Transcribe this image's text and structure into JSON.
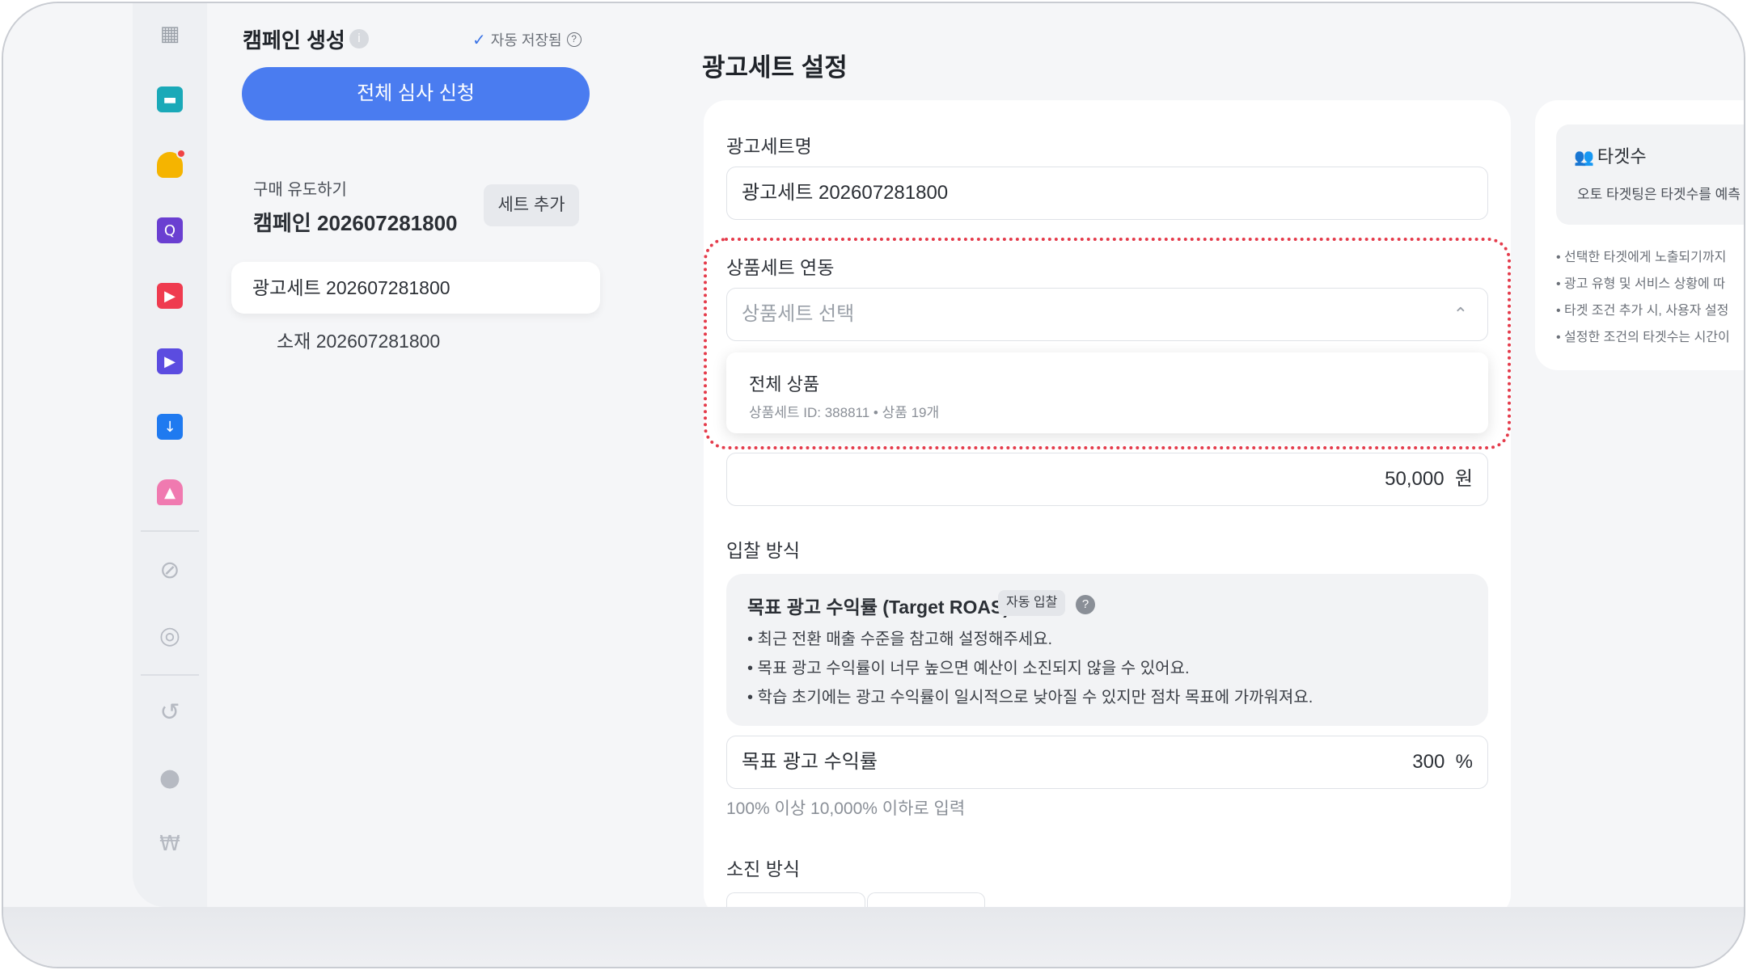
{
  "sidebar": {
    "icons": [
      "grid-icon",
      "image-icon",
      "bell-icon",
      "search-app-icon",
      "film-icon",
      "video-camera-icon",
      "download-icon",
      "stamp-icon",
      "paperclip-icon",
      "target-icon",
      "history-icon",
      "money-bag-icon",
      "won-icon"
    ],
    "colors": {
      "image": "#1aa9b8",
      "bell": "#f5b400",
      "search_app": "#6a3fd1",
      "film": "#ef3b4f",
      "video": "#5b4ce0",
      "download": "#1f7af0",
      "stamp": "#f07ab0"
    }
  },
  "left_panel": {
    "title": "캠페인 생성",
    "autosave": "자동 저장됨",
    "submit_all": "전체 심사 신청",
    "campaign_goal": "구매 유도하기",
    "campaign_name": "캠페인 202607281800",
    "add_set": "세트 추가",
    "adset_item": "광고세트 202607281800",
    "creative_item": "소재 202607281800"
  },
  "main": {
    "title": "광고세트 설정",
    "adset_name_label": "광고세트명",
    "adset_name_value": "광고세트 202607281800",
    "product_set_label": "상품세트 연동",
    "product_set_placeholder": "상품세트 선택",
    "dropdown_option_title": "전체 상품",
    "dropdown_option_sub": "상품세트 ID: 388811 • 상품 19개",
    "budget_value": "50,000",
    "budget_unit": "원",
    "bid_label": "입찰 방식",
    "bid_title": "목표 광고 수익률 (Target ROAS)",
    "bid_badge": "자동 입찰",
    "bid_bullets": [
      "• 최근 전환 매출 수준을 참고해 설정해주세요.",
      "• 목표 광고 수익률이 너무 높으면 예산이 소진되지 않을 수 있어요.",
      "• 학습 초기에는 광고 수익률이 일시적으로 낮아질 수 있지만 점차 목표에 가까워져요."
    ],
    "roas_label": "목표 광고 수익률",
    "roas_value": "300",
    "roas_unit": "%",
    "roas_hint": "100% 이상 10,000% 이하로 입력",
    "spend_label": "소진 방식"
  },
  "right_panel": {
    "title": "타겟수",
    "desc": "오토 타겟팅은 타겟수를 예측",
    "notes": [
      "• 선택한 타겟에게 노출되기까지",
      "• 광고 유형 및 서비스 상황에 따",
      "• 타겟 조건 추가 시, 사용자 설정",
      "• 설정한 조건의 타겟수는 시간이"
    ]
  },
  "colors": {
    "accent": "#4a7cf0",
    "highlight": "#e43b4b"
  }
}
